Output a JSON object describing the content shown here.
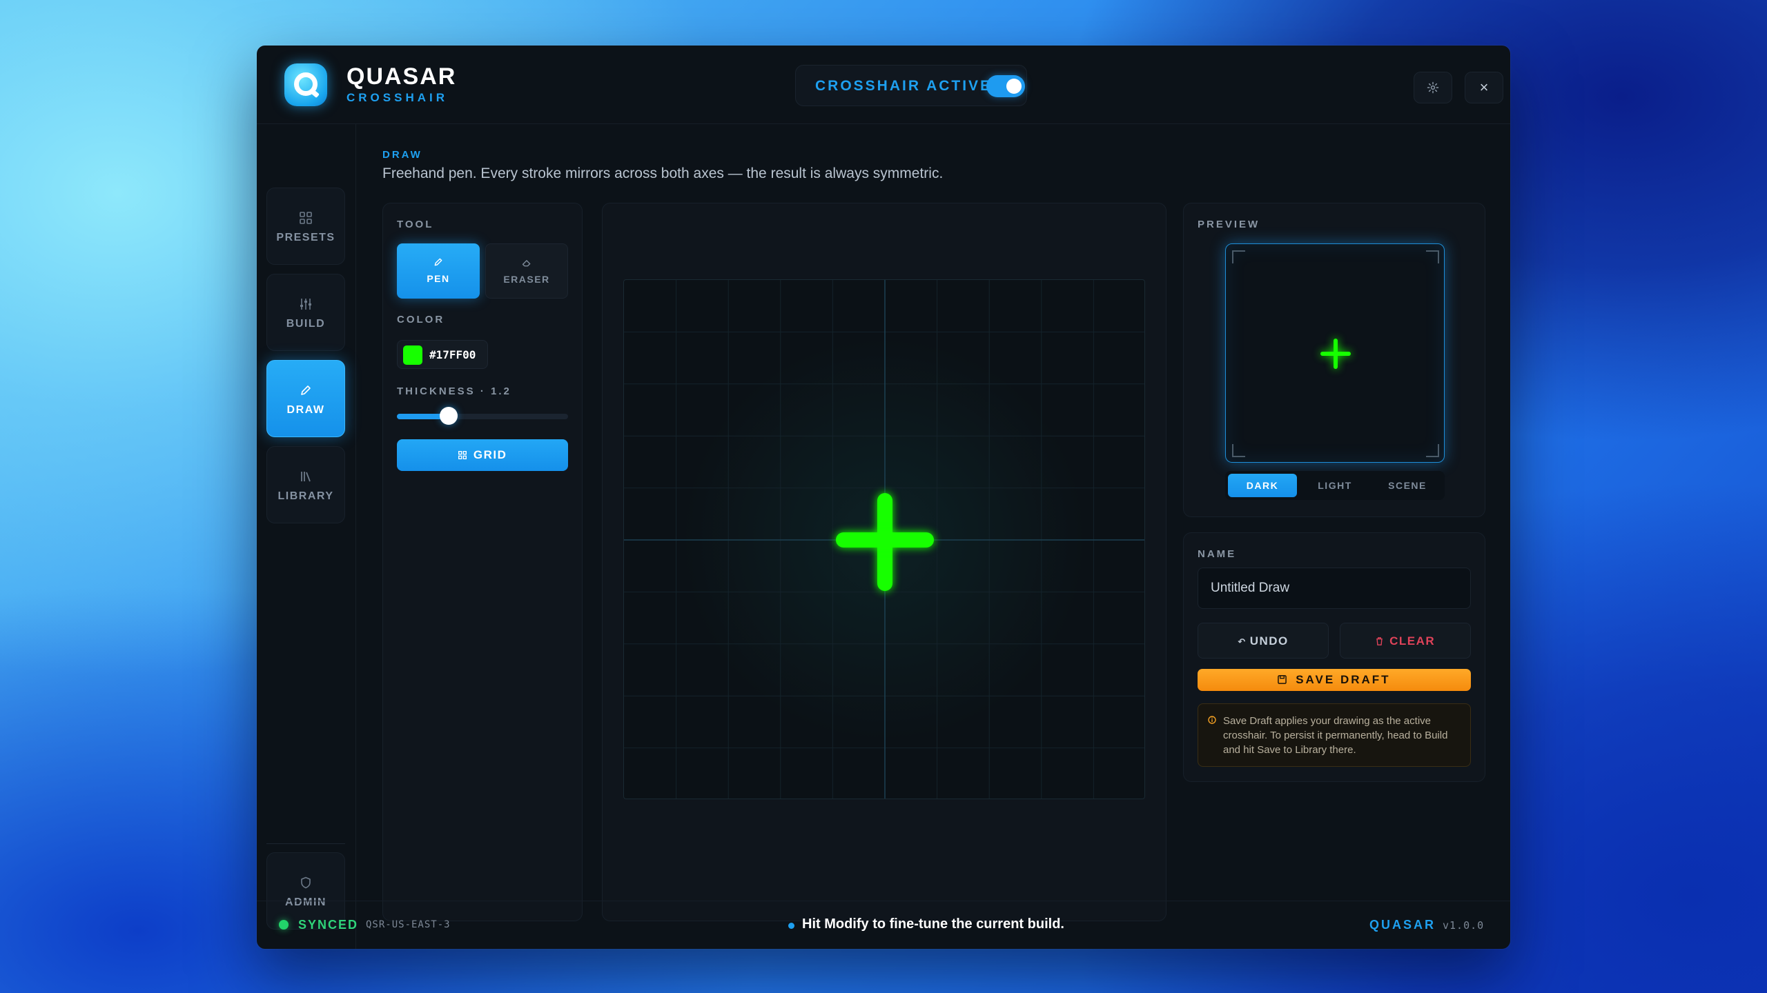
{
  "header": {
    "brand_title": "QUASAR",
    "brand_subtitle": "CROSSHAIR",
    "crosshair_toggle_label": "CROSSHAIR ACTIVE",
    "crosshair_active": true,
    "settings_icon": "gear-icon",
    "close_icon": "close-icon",
    "close_glyph": "×"
  },
  "sidebar": {
    "items": [
      {
        "label": "PRESETS",
        "icon": "grid-icon",
        "active": false
      },
      {
        "label": "BUILD",
        "icon": "sliders-icon",
        "active": false
      },
      {
        "label": "DRAW",
        "icon": "pencil-icon",
        "active": true
      },
      {
        "label": "LIBRARY",
        "icon": "books-icon",
        "active": false
      }
    ],
    "admin": {
      "label": "ADMIN",
      "icon": "shield-icon"
    }
  },
  "main": {
    "section_tag": "DRAW",
    "description": "Freehand pen. Every stroke mirrors across both axes — the result is always symmetric."
  },
  "tools": {
    "tool_label": "TOOL",
    "pen_label": "PEN",
    "eraser_label": "ERASER",
    "active_tool": "pen",
    "color_label": "COLOR",
    "color_hex": "#17FF00",
    "thickness_label": "THICKNESS · 1.2",
    "thickness_fraction": 0.25,
    "grid_label": "GRID"
  },
  "preview": {
    "label": "PREVIEW",
    "tabs": [
      "DARK",
      "LIGHT",
      "SCENE"
    ],
    "active_tab": "DARK"
  },
  "name_panel": {
    "label": "NAME",
    "value": "Untitled Draw",
    "undo_label": "UNDO",
    "clear_label": "CLEAR",
    "save_label": "SAVE DRAFT",
    "note": "Save Draft applies your drawing as the active crosshair. To persist it permanently, head to Build and hit Save to Library there."
  },
  "footer": {
    "status": "SYNCED",
    "region": "QSR-US-EAST-3",
    "tip": "Hit Modify to fine-tune the current build.",
    "brand": "QUASAR",
    "version": "v1.0.0"
  },
  "colors": {
    "accent": "#1ea0f0",
    "crosshair": "#17FF00",
    "save": "#f7931a",
    "clear": "#e0435a",
    "synced": "#2fd47a"
  }
}
